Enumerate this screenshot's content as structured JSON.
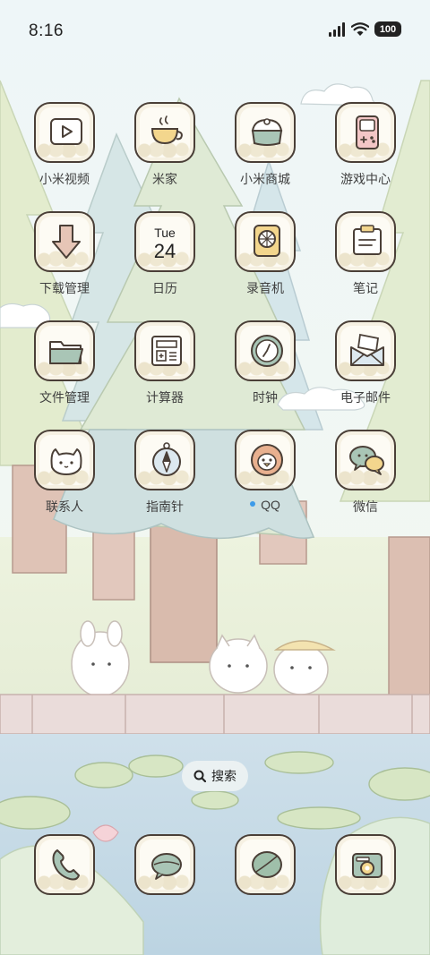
{
  "status_bar": {
    "time": "8:16",
    "battery": "100",
    "icons": [
      "signal-icon",
      "wifi-icon",
      "battery-icon"
    ]
  },
  "apps": [
    {
      "label": "小米视频",
      "icon": "video-play-icon"
    },
    {
      "label": "米家",
      "icon": "teacup-icon"
    },
    {
      "label": "小米商城",
      "icon": "cake-bowl-icon"
    },
    {
      "label": "游戏中心",
      "icon": "game-console-icon"
    },
    {
      "label": "下载管理",
      "icon": "download-arrow-icon"
    },
    {
      "label": "日历",
      "icon": "calendar-icon",
      "day": "Tue",
      "date": "24"
    },
    {
      "label": "录音机",
      "icon": "microphone-icon"
    },
    {
      "label": "笔记",
      "icon": "note-icon"
    },
    {
      "label": "文件管理",
      "icon": "folder-icon"
    },
    {
      "label": "计算器",
      "icon": "calculator-icon"
    },
    {
      "label": "时钟",
      "icon": "clock-icon"
    },
    {
      "label": "电子邮件",
      "icon": "envelope-icon"
    },
    {
      "label": "联系人",
      "icon": "cat-face-icon"
    },
    {
      "label": "指南针",
      "icon": "compass-icon"
    },
    {
      "label": "QQ",
      "icon": "penguin-icon",
      "badge": "new-dot"
    },
    {
      "label": "微信",
      "icon": "chat-bubbles-icon"
    }
  ],
  "search": {
    "label": "搜索",
    "icon": "search-icon"
  },
  "dock": [
    {
      "icon": "phone-icon"
    },
    {
      "icon": "message-bubble-icon"
    },
    {
      "icon": "leaf-browser-icon"
    },
    {
      "icon": "camera-icon"
    }
  ],
  "colors": {
    "icon_border": "#4a3f37",
    "icon_fill": "#f6f1e3",
    "accent_green": "#a9c5b6",
    "accent_yellow": "#f3d68d",
    "accent_pink": "#e9a9a9",
    "notification_dot": "#3d9be9"
  }
}
